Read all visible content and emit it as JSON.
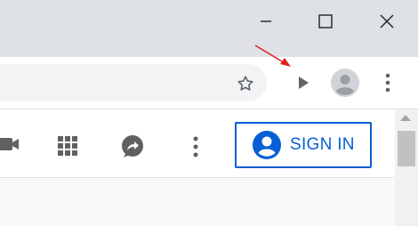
{
  "window": {
    "controls": [
      "minimize-icon",
      "maximize-icon",
      "close-icon"
    ]
  },
  "toolbar": {
    "icons": [
      "star-icon",
      "play-extension-icon",
      "profile-avatar-icon",
      "more-vert-icon"
    ]
  },
  "page": {
    "header_icons": [
      "video-camera-icon",
      "apps-grid-icon",
      "share-icon",
      "more-vert-icon"
    ],
    "signin_label": "SIGN IN",
    "accent_color": "#065fd4"
  },
  "annotation": {
    "arrow_color": "#e02020",
    "points_to": "play-extension-icon"
  }
}
